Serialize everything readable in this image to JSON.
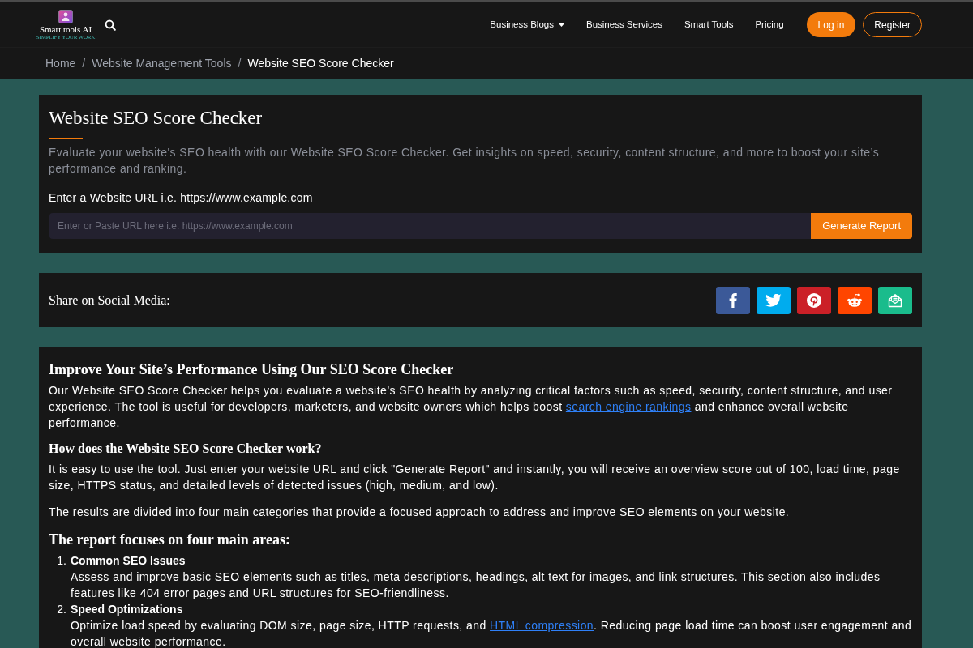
{
  "header": {
    "logo": {
      "name": "Smart tools AI",
      "tagline": "SIMPLIFY YOUR WORK"
    },
    "nav": [
      {
        "label": "Business Blogs",
        "dropdown": true
      },
      {
        "label": "Business Services",
        "dropdown": false
      },
      {
        "label": "Smart Tools",
        "dropdown": false
      },
      {
        "label": "Pricing",
        "dropdown": false
      }
    ],
    "buttons": [
      {
        "label": "Log in",
        "kind": "filled"
      },
      {
        "label": "Register",
        "kind": "outline"
      }
    ]
  },
  "breadcrumb": [
    {
      "label": "Home",
      "current": false
    },
    {
      "separator": "/",
      "label": "Website Management Tools",
      "current": false
    },
    {
      "separator": "/",
      "label": "Website SEO Score Checker",
      "current": true
    }
  ],
  "tool": {
    "title": "Website SEO Score Checker",
    "description": "Evaluate your website's SEO health with our Website SEO Score Checker. Get insights on speed, security, content structure, and more to boost your site’s performance and ranking.",
    "url_label": "Enter a Website URL i.e. https://www.example.com",
    "url_field": {
      "placeholder": "Enter or Paste URL here i.e. https://www.example.com"
    },
    "submit": "Generate Report"
  },
  "share": {
    "label": "Share on Social Media:",
    "buttons": [
      {
        "kind": "facebook",
        "color": "#3b5998"
      },
      {
        "kind": "twitter",
        "color": "#00acee"
      },
      {
        "kind": "pinterest",
        "color": "#cb2027"
      },
      {
        "kind": "reddit",
        "color": "#ff4500"
      },
      {
        "kind": "email",
        "color": "#1abc8c"
      }
    ]
  },
  "article": [
    {
      "kind": "heading",
      "text": "Improve Your Site’s Performance Using Our SEO Score Checker"
    },
    {
      "kind": "paragraph",
      "parts": [
        {
          "text": "Our Website SEO Score Checker helps you evaluate a website’s SEO health by analyzing critical factors such as speed, security, content structure, and user experience.  The tool is useful for developers, marketers, and website owners which helps boost ",
          "link": false
        },
        {
          "text": "search engine rankings",
          "link": true
        },
        {
          "text": " and enhance overall website performance.",
          "link": false
        }
      ]
    },
    {
      "kind": "subheading",
      "text": "How does the Website SEO Score Checker work?"
    },
    {
      "kind": "paragraph",
      "parts": [
        {
          "text": "It is easy to use the tool. Just enter your website URL and click \"Generate Report\" and instantly, you will receive an overview score out of 100, load time, page size, HTTPS status, and detailed levels of detected issues (high, medium, and low).",
          "link": false
        }
      ]
    },
    {
      "kind": "paragraph",
      "parts": [
        {
          "text": "The results are divided into four main categories that provide a focused approach to address and improve SEO elements on your website.",
          "link": false
        }
      ]
    },
    {
      "kind": "heading",
      "text": "The report focuses on four main areas:"
    },
    {
      "kind": "list",
      "items": [
        {
          "number": "1.",
          "title": "Common SEO Issues",
          "parts": [
            {
              "text": "Assess and improve basic SEO elements such as titles, meta descriptions, headings, alt text for images, and link structures. This section also includes features like 404 error pages and URL structures for SEO-friendliness.",
              "link": false
            }
          ]
        },
        {
          "number": "2.",
          "title": "Speed Optimizations",
          "parts": [
            {
              "text": "Optimize load speed by evaluating DOM size, page size, HTTP requests, and ",
              "link": false
            },
            {
              "text": "HTML compression",
              "link": true
            },
            {
              "text": ". Reducing page load time can boost user engagement and overall website performance.",
              "link": false
            }
          ]
        }
      ]
    }
  ]
}
